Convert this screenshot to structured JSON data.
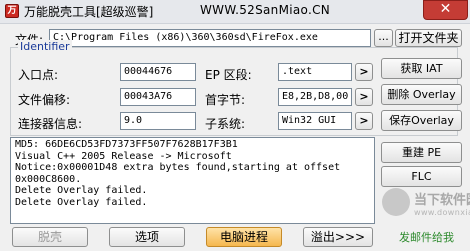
{
  "titlebar": {
    "app_icon_glyph": "万",
    "title": "万能脱壳工具[超级巡警]",
    "url": "WWW.52SanMiao.CN",
    "close_glyph": "✕",
    "close_color": "#c43c35"
  },
  "file_row": {
    "label": "文件:",
    "path": "C:\\Program Files (x86)\\360\\360sd\\FireFox.exe",
    "browse_label": "...",
    "open_folder_label": "打开文件夹"
  },
  "identifier": {
    "group_title": "Identifier",
    "entry_point_label": "入口点:",
    "entry_point_value": "00044676",
    "file_offset_label": "文件偏移:",
    "file_offset_value": "00043A76",
    "linker_label": "连接器信息:",
    "linker_value": "9.0",
    "ep_section_label": "EP  区段:",
    "ep_section_value": ".text",
    "first_bytes_label": "首字节:",
    "first_bytes_value": "E8,2B,D8,00",
    "subsystem_label": "子系统:",
    "subsystem_value": "Win32 GUI",
    "arrow_glyph": ">"
  },
  "side_buttons": {
    "get_iat": "获取 IAT",
    "delete_overlay": "删除 Overlay",
    "save_overlay": "保存Overlay",
    "rebuild_pe": "重建 PE",
    "flc": "FLC"
  },
  "log": {
    "lines": [
      "MD5: 66DE6CD53FD7373FF507F7628B17F3B1",
      "Visual C++ 2005 Release -> Microsoft",
      "Notice:0x00001D48 extra bytes found,starting at offset",
      "0x000C8600.",
      "Delete Overlay failed.",
      "Delete Overlay failed."
    ]
  },
  "bottom_bar": {
    "unpack_label": "脱壳",
    "options_label": "选项",
    "process_label": "电脑进程",
    "exit_label": "溢出>>>",
    "publish_link": "发邮件给我"
  },
  "watermark": {
    "text_line1": "当下软件园",
    "text_line2": "www.downxia.com"
  }
}
